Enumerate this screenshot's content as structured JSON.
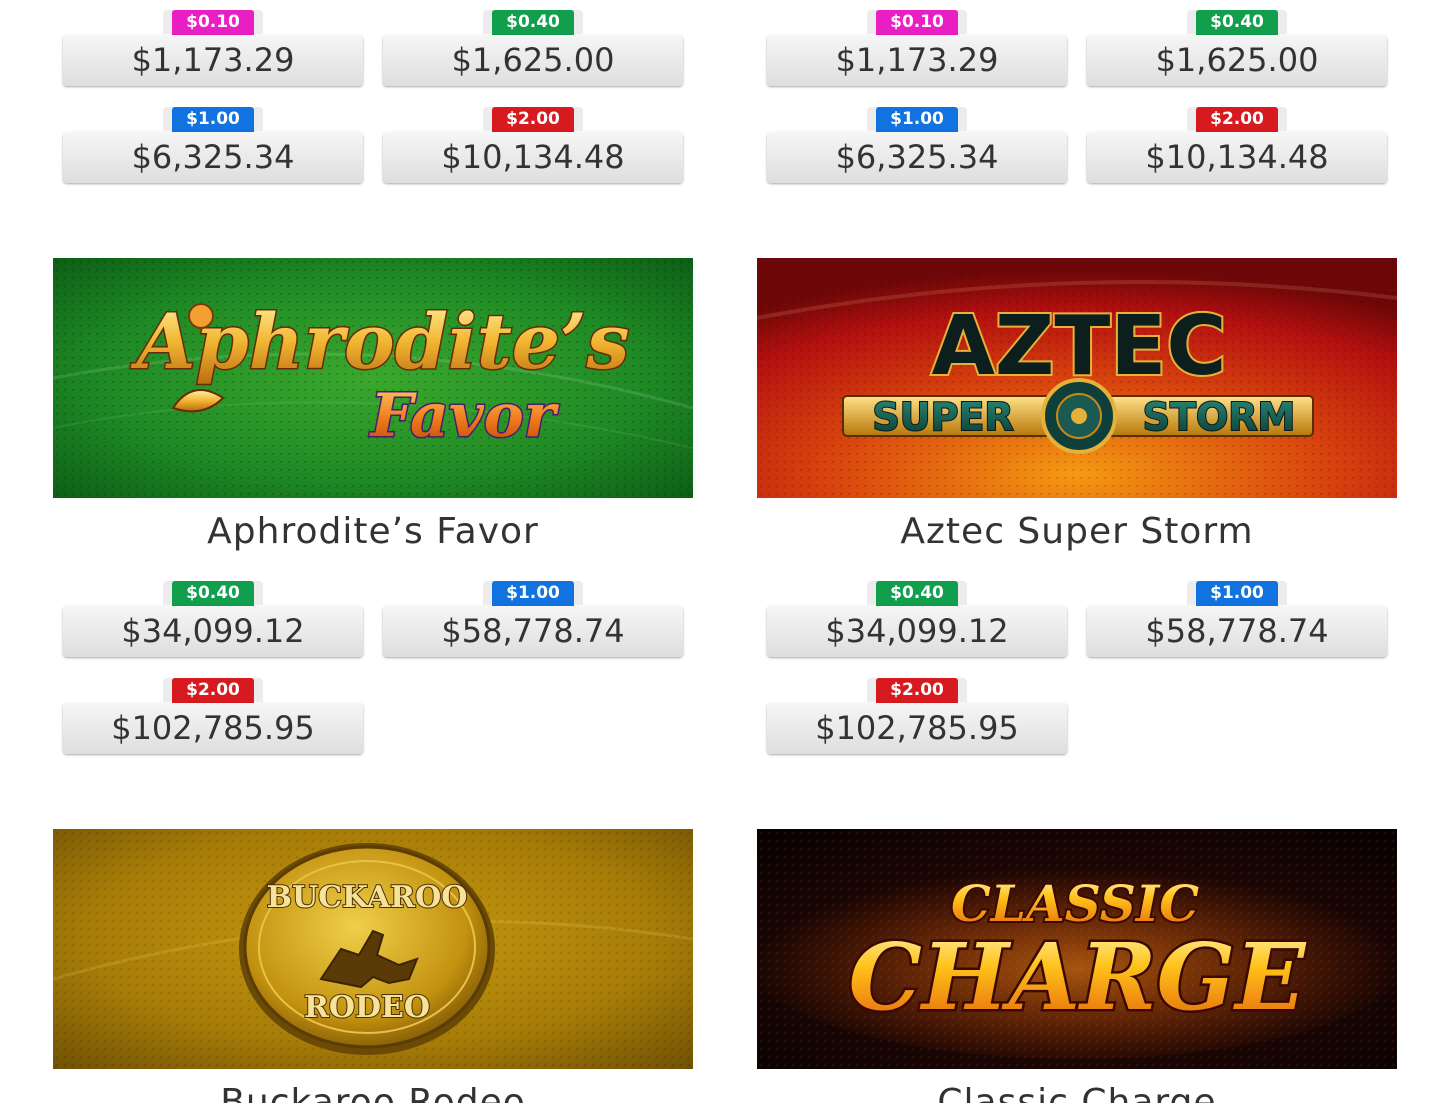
{
  "colors": {
    "badge_pink": "#e91ec3",
    "badge_green": "#119e4d",
    "badge_blue": "#1173e0",
    "badge_red": "#d71a20"
  },
  "top_row": {
    "left": {
      "jackpots": [
        {
          "denom": "$0.10",
          "color": "#e91ec3",
          "amount": "$1,173.29"
        },
        {
          "denom": "$0.40",
          "color": "#119e4d",
          "amount": "$1,625.00"
        },
        {
          "denom": "$1.00",
          "color": "#1173e0",
          "amount": "$6,325.34"
        },
        {
          "denom": "$2.00",
          "color": "#d71a20",
          "amount": "$10,134.48"
        }
      ]
    },
    "right": {
      "jackpots": [
        {
          "denom": "$0.10",
          "color": "#e91ec3",
          "amount": "$1,173.29"
        },
        {
          "denom": "$0.40",
          "color": "#119e4d",
          "amount": "$1,625.00"
        },
        {
          "denom": "$1.00",
          "color": "#1173e0",
          "amount": "$6,325.34"
        },
        {
          "denom": "$2.00",
          "color": "#d71a20",
          "amount": "$10,134.48"
        }
      ]
    }
  },
  "games": [
    {
      "title": "Aphrodite’s Favor",
      "logo_line1": "Aphrodite’s",
      "logo_line2": "Favor",
      "jackpots": [
        {
          "denom": "$0.40",
          "color": "#119e4d",
          "amount": "$34,099.12"
        },
        {
          "denom": "$1.00",
          "color": "#1173e0",
          "amount": "$58,778.74"
        },
        {
          "denom": "$2.00",
          "color": "#d71a20",
          "amount": "$102,785.95"
        }
      ]
    },
    {
      "title": "Aztec Super Storm",
      "logo_line1": "AZTEC",
      "logo_line2a": "SUPER",
      "logo_line2b": "STORM",
      "jackpots": [
        {
          "denom": "$0.40",
          "color": "#119e4d",
          "amount": "$34,099.12"
        },
        {
          "denom": "$1.00",
          "color": "#1173e0",
          "amount": "$58,778.74"
        },
        {
          "denom": "$2.00",
          "color": "#d71a20",
          "amount": "$102,785.95"
        }
      ]
    },
    {
      "title": "Buckaroo Rodeo",
      "logo_line1": "BUCKAROO",
      "logo_line2": "RODEO"
    },
    {
      "title": "Classic Charge",
      "logo_line1": "CLASSIC",
      "logo_line2": "CHARGE"
    }
  ]
}
